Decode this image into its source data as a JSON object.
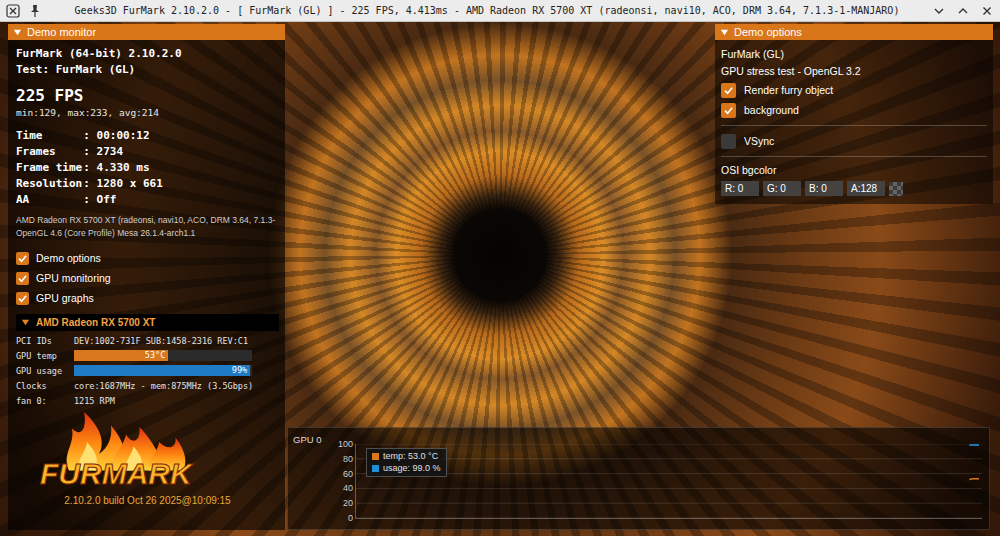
{
  "window": {
    "title": "Geeks3D FurMark 2.10.2.0 - [ FurMark (GL) ] - 225 FPS, 4.413ms - AMD Radeon RX 5700 XT (radeonsi, navi10, ACO, DRM 3.64, 7.1.3-1-MANJARO)"
  },
  "demo_monitor": {
    "header": "Demo monitor",
    "app": "FurMark (64-bit) 2.10.2.0",
    "test": "Test: FurMark (GL)",
    "fps": "225 FPS",
    "fps_stats": "min:129, max:233, avg:214",
    "stats": [
      {
        "label": "Time",
        "value": ": 00:00:12"
      },
      {
        "label": "Frames",
        "value": ": 2734"
      },
      {
        "label": "Frame time",
        "value": ": 4.330 ms"
      },
      {
        "label": "Resolution",
        "value": ": 1280 x 661"
      },
      {
        "label": "AA",
        "value": ": Off"
      }
    ],
    "renderer": "AMD Radeon RX 5700 XT (radeonsi, navi10, ACO, DRM 3.64, 7.1.3-",
    "gl_version": "OpenGL 4.6 (Core Profile) Mesa 26.1.4-arch1.1",
    "toggles": [
      {
        "label": "Demo options",
        "checked": true
      },
      {
        "label": "GPU monitoring",
        "checked": true
      },
      {
        "label": "GPU graphs",
        "checked": true
      }
    ]
  },
  "gpu": {
    "name": "AMD Radeon RX 5700 XT",
    "rows": [
      {
        "kind": "text",
        "label": "PCI IDs",
        "value": "DEV:1002-731F SUB:1458-2316 REV:C1"
      },
      {
        "kind": "bar",
        "label": "GPU temp",
        "reading": "53°C",
        "level": 0.53,
        "color": "#d9781c"
      },
      {
        "kind": "bar",
        "label": "GPU usage",
        "reading": "99%",
        "level": 0.99,
        "color": "#1f7bc4"
      },
      {
        "kind": "text",
        "label": "Clocks",
        "value": "core:1687MHz - mem:875MHz (3.5Gbps)"
      },
      {
        "kind": "text",
        "label": "fan 0:",
        "value": "1215 RPM"
      }
    ]
  },
  "logo": {
    "text": "FURMARK",
    "build": "2.10.2.0 build Oct 26 2025@10:09:15"
  },
  "demo_options": {
    "header": "Demo options",
    "title": "FurMark (GL)",
    "subtitle": "GPU stress test - OpenGL 3.2",
    "option_groups": [
      [
        {
          "label": "Render furry object",
          "checked": true
        },
        {
          "label": "background",
          "checked": true
        }
      ],
      [
        {
          "label": "VSync",
          "checked": false
        }
      ]
    ],
    "bgcolor": {
      "label": "OSI bgcolor",
      "fields": [
        "R: 0",
        "G: 0",
        "B: 0",
        "A:128"
      ],
      "swatch_rgba": [
        0,
        0,
        0,
        128
      ]
    }
  },
  "graph": {
    "title": "GPU 0",
    "y_ticks": [
      "100",
      "80",
      "60",
      "40",
      "20",
      "0"
    ],
    "series": [
      {
        "name": "temp: 53.0 °C",
        "color": "#d9781c",
        "values": [
          52,
          53,
          53,
          53
        ]
      },
      {
        "name": "usage: 99.0 %",
        "color": "#1f8fd8",
        "values": [
          99,
          99,
          99,
          99
        ]
      }
    ]
  }
}
